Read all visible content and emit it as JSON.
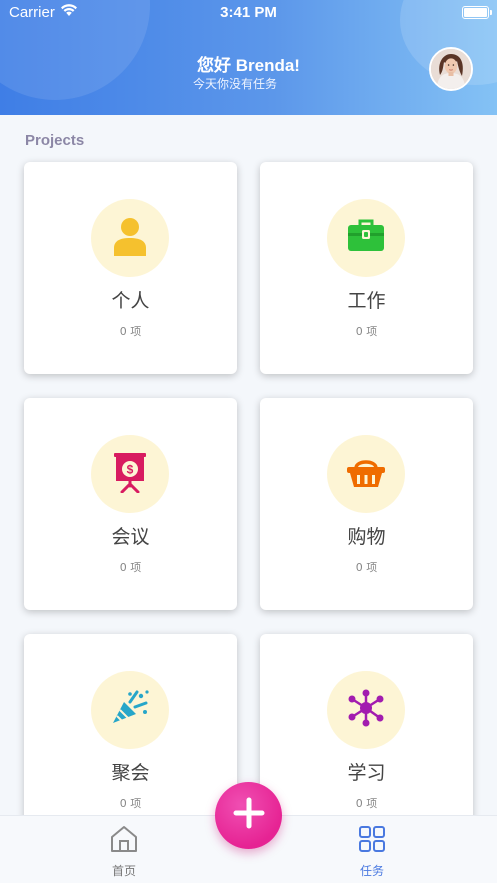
{
  "status_bar": {
    "carrier": "Carrier",
    "time": "3:41 PM"
  },
  "header": {
    "greeting": "您好 Brenda!",
    "subtitle": "今天你没有任务"
  },
  "section_title": "Projects",
  "projects": [
    {
      "name": "个人",
      "count": "0 项",
      "icon": "person-icon",
      "color": "#f5c12e"
    },
    {
      "name": "工作",
      "count": "0 项",
      "icon": "briefcase-icon",
      "color": "#2ec13a"
    },
    {
      "name": "会议",
      "count": "0 项",
      "icon": "presentation-board-icon",
      "color": "#d81b60"
    },
    {
      "name": "购物",
      "count": "0 项",
      "icon": "shopping-basket-icon",
      "color": "#ef6c00"
    },
    {
      "name": "聚会",
      "count": "0 项",
      "icon": "party-popper-icon",
      "color": "#26a6c9"
    },
    {
      "name": "学习",
      "count": "0 项",
      "icon": "molecule-icon",
      "color": "#a21caf"
    }
  ],
  "tabbar": {
    "home_label": "首页",
    "tasks_label": "任务"
  },
  "colors": {
    "accent": "#4a79e0",
    "fab": "#e62393",
    "icon_bg": "#fdf5d5"
  }
}
